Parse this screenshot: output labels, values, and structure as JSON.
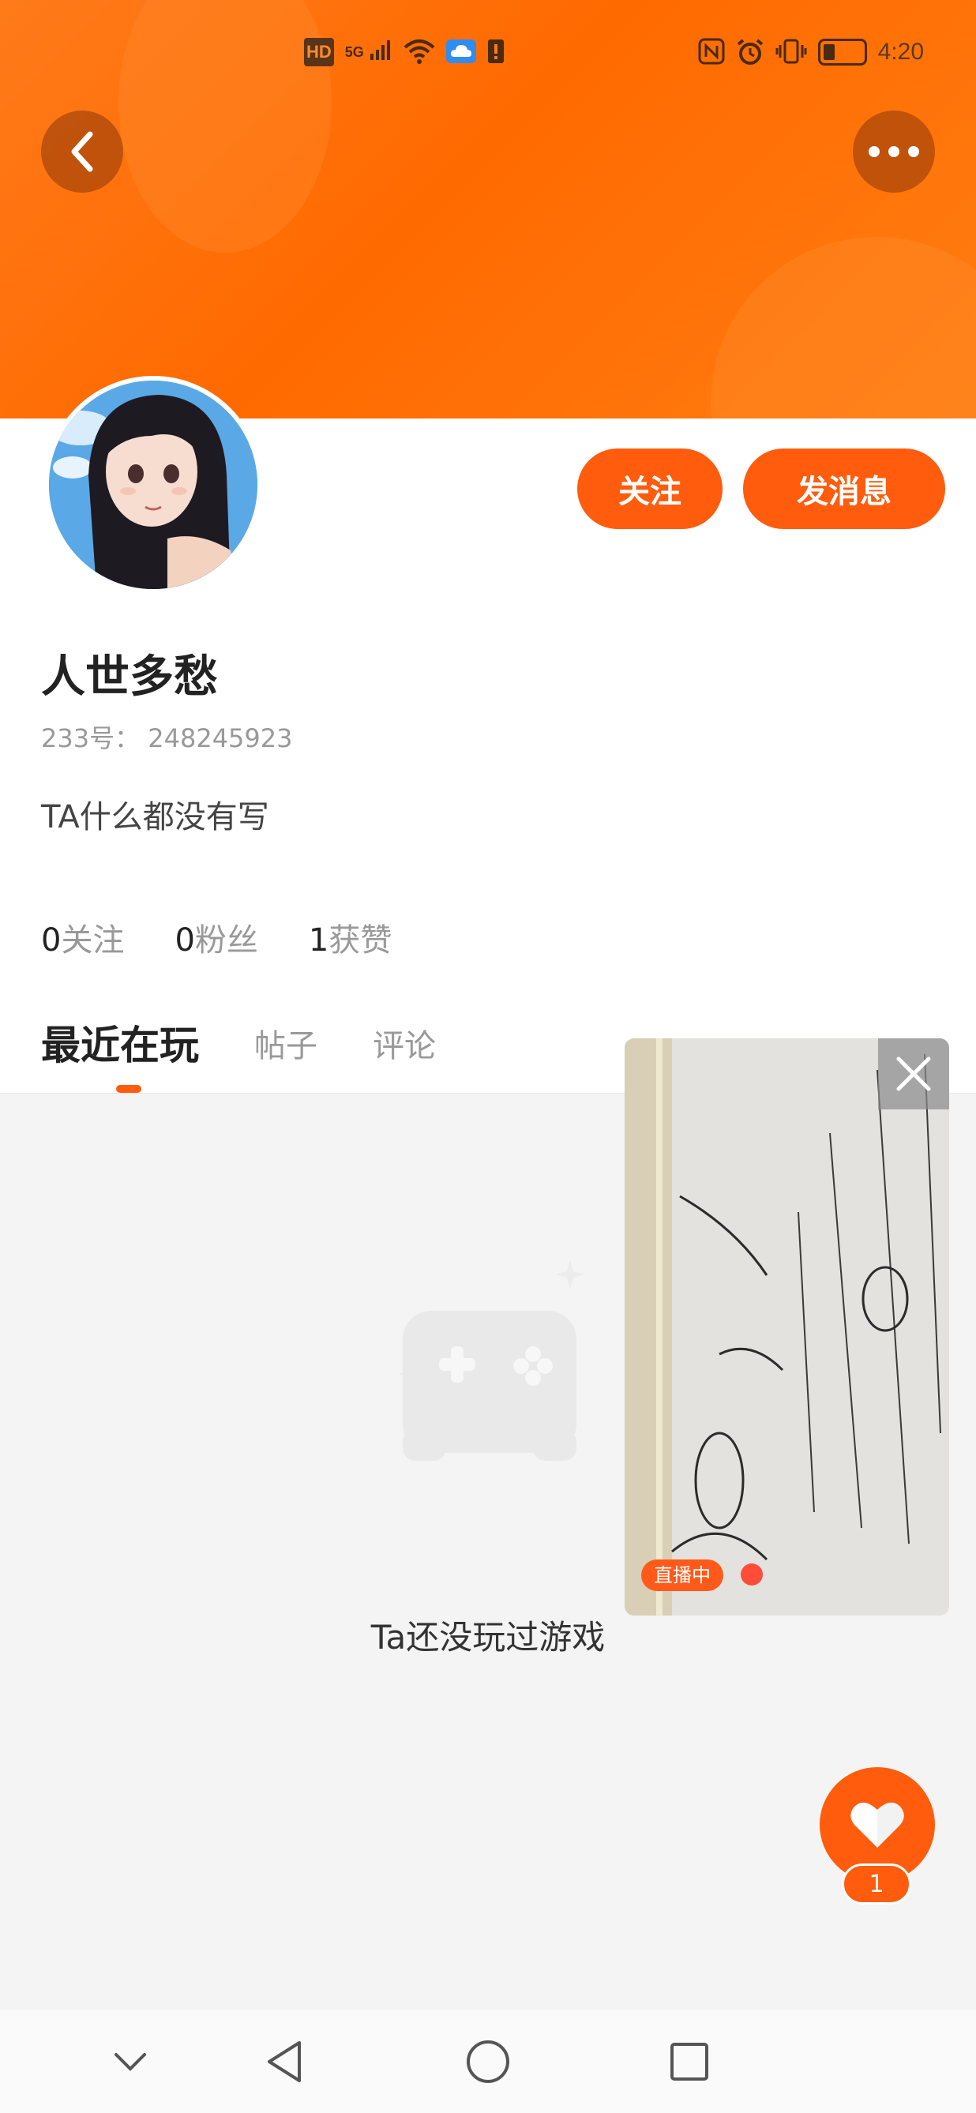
{
  "status_bar": {
    "left_icons": [
      "hd-icon",
      "5g-signal-icon",
      "wifi-icon",
      "cloud-icon",
      "sim-alert-icon"
    ],
    "hd_label": "HD",
    "net_label": "5G",
    "right_icons": [
      "nfc-icon",
      "alarm-icon",
      "vibrate-icon",
      "battery-icon"
    ],
    "time": "4:20",
    "battery_level": 0.25
  },
  "header": {
    "back_icon": "chevron-left-icon",
    "more_icon": "more-horizontal-icon",
    "accent": "#ff6a00"
  },
  "profile": {
    "name": "人世多愁",
    "id_line": "233号： 248245923",
    "bio": "TA什么都没有写",
    "follow_label": "关注",
    "message_label": "发消息",
    "stats": [
      {
        "num": "0",
        "label": "关注"
      },
      {
        "num": "0",
        "label": "粉丝"
      },
      {
        "num": "1",
        "label": "获赞"
      }
    ]
  },
  "tabs": [
    {
      "label": "最近在玩",
      "active": true
    },
    {
      "label": "帖子",
      "active": false
    },
    {
      "label": "评论",
      "active": false
    }
  ],
  "empty_state": {
    "icon": "gamepad-icon",
    "text": "Ta还没玩过游戏"
  },
  "live_window": {
    "badge": "直播中",
    "close_icon": "close-icon"
  },
  "like": {
    "icon": "heart-icon",
    "count": "1"
  },
  "nav_bar": {
    "icons": [
      "collapse-down-icon",
      "back-triangle-icon",
      "home-circle-icon",
      "recent-square-icon"
    ]
  }
}
